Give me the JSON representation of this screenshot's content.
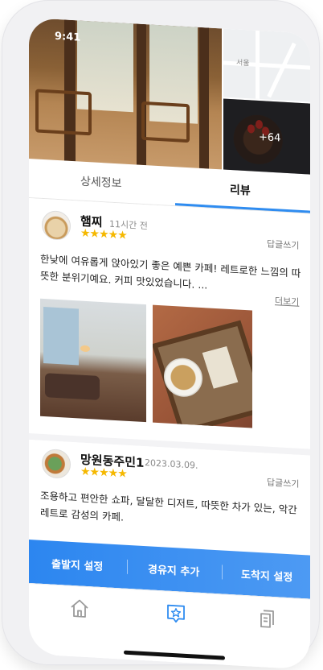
{
  "status": {
    "time": "9:41"
  },
  "hero": {
    "map_label": "서울",
    "more_photos": "+64"
  },
  "tabs": [
    {
      "label": "상세정보",
      "active": false
    },
    {
      "label": "리뷰",
      "active": true
    }
  ],
  "reviews": [
    {
      "name": "햄찌",
      "time": "11시간 전",
      "stars": "★★★★★",
      "reply": "답글쓰기",
      "text": "한낮에 여유롭게 앉아있기 좋은 예쁜 카페! 레트로한 느낌의 따뜻한 분위기예요. 커피 맛있었습니다.   ...",
      "more": "더보기"
    },
    {
      "name": "망원동주민1",
      "time": "2023.03.09.",
      "stars": "★★★★★",
      "reply": "답글쓰기",
      "text": "조용하고 편안한 쇼파, 달달한 디저트, 따뜻한 차가 있는, 악간 레트로 감성의 카페."
    }
  ],
  "actions": [
    {
      "label": "출발지 설정"
    },
    {
      "label": "경유지 추가"
    },
    {
      "label": "도착지 설정"
    }
  ],
  "colors": {
    "accent": "#2f8cf0",
    "star": "#f5b800"
  },
  "tabbar": {
    "icons": [
      "home-icon",
      "review-star-icon",
      "document-icon"
    ]
  }
}
